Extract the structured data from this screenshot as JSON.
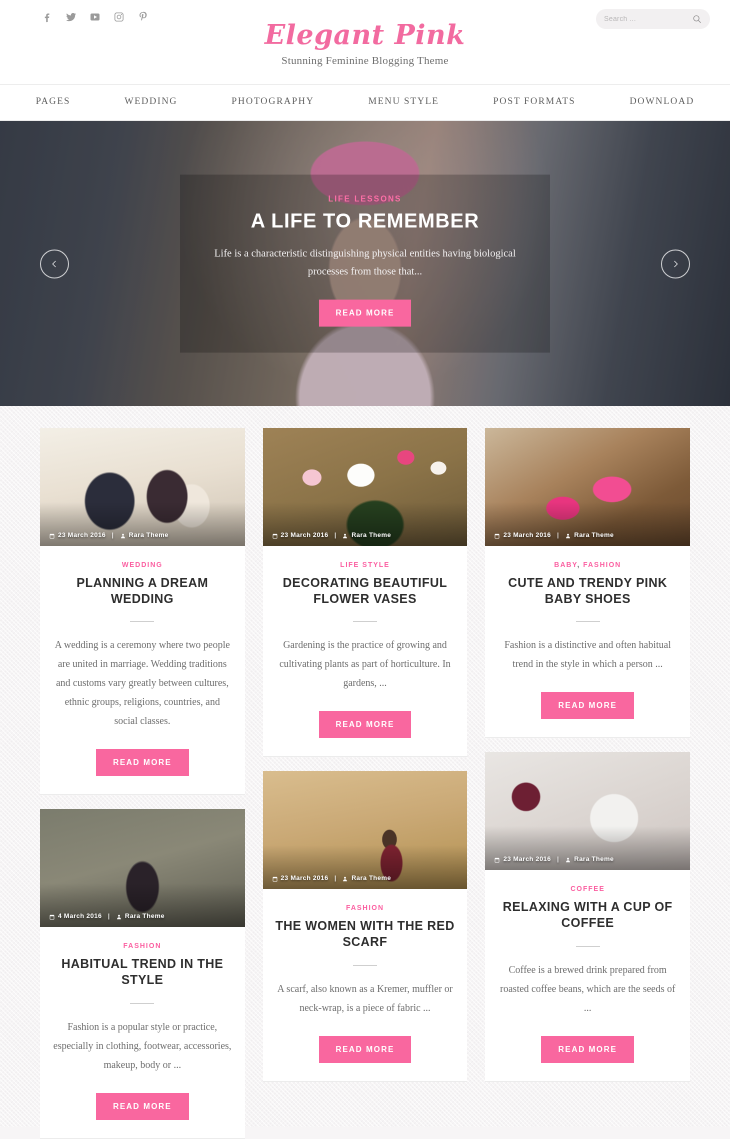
{
  "header": {
    "brand_title": "Elegant Pink",
    "tagline": "Stunning Feminine Blogging Theme",
    "social": [
      {
        "name": "facebook-icon",
        "label": "Facebook"
      },
      {
        "name": "twitter-icon",
        "label": "Twitter"
      },
      {
        "name": "youtube-icon",
        "label": "YouTube"
      },
      {
        "name": "instagram-icon",
        "label": "Instagram"
      },
      {
        "name": "pinterest-icon",
        "label": "Pinterest"
      }
    ],
    "search": {
      "placeholder": "Search ...",
      "value": "",
      "icon": "search-icon"
    }
  },
  "nav": {
    "items": [
      {
        "label": "PAGES"
      },
      {
        "label": "WEDDING"
      },
      {
        "label": "PHOTOGRAPHY"
      },
      {
        "label": "MENU STYLE"
      },
      {
        "label": "POST FORMATS"
      },
      {
        "label": "DOWNLOAD"
      }
    ]
  },
  "hero": {
    "category": "LIFE LESSONS",
    "title": "A LIFE TO REMEMBER",
    "excerpt": "Life is a characteristic distinguishing physical entities having biological processes from those that...",
    "read_more": "READ MORE",
    "prev_icon": "chevron-left-icon",
    "next_icon": "chevron-right-icon"
  },
  "colors": {
    "accent_pink": "#f9679f",
    "brand_pink": "#f26ba0",
    "text_dark": "#2e2e2e",
    "text_body": "#6d6d6d",
    "page_bg": "#f6f4f5"
  },
  "posts": [
    {
      "categories": [
        {
          "label": "WEDDING"
        }
      ],
      "title": "PLANNING A DREAM WEDDING",
      "excerpt": "A wedding is a ceremony where two people are united in marriage. Wedding traditions and customs vary greatly between cultures, ethnic groups, religions, countries, and social classes.",
      "read_more": "READ MORE",
      "date": "23 March 2016",
      "author": "Rara Theme",
      "meta_separator": "|",
      "thumb": "thumb-wedding"
    },
    {
      "categories": [
        {
          "label": "LIFE STYLE"
        }
      ],
      "title": "DECORATING BEAUTIFUL FLOWER VASES",
      "excerpt": "Gardening is the practice of growing and cultivating plants as part of horticulture. In gardens, ...",
      "read_more": "READ MORE",
      "date": "23 March 2016",
      "author": "Rara Theme",
      "meta_separator": "|",
      "thumb": "thumb-flowers"
    },
    {
      "categories": [
        {
          "label": "BABY"
        },
        {
          "label": "FASHION"
        }
      ],
      "title": "CUTE AND TRENDY PINK BABY SHOES",
      "excerpt": "Fashion is a distinctive and often habitual trend in the style in which a person ...",
      "read_more": "READ MORE",
      "date": "23 March 2016",
      "author": "Rara Theme",
      "meta_separator": "|",
      "thumb": "thumb-shoes"
    },
    {
      "categories": [
        {
          "label": "FASHION"
        }
      ],
      "title": "HABITUAL TREND IN THE STYLE",
      "excerpt": "Fashion is a popular style or practice, especially in clothing, footwear, accessories, makeup, body or ...",
      "read_more": "READ MORE",
      "date": "4 March 2016",
      "author": "Rara Theme",
      "meta_separator": "|",
      "thumb": "thumb-sunglasses"
    },
    {
      "categories": [
        {
          "label": "FASHION"
        }
      ],
      "title": "THE WOMEN WITH THE RED SCARF",
      "excerpt": "A scarf, also known as a Kremer, muffler or neck-wrap, is a piece of fabric ...",
      "read_more": "READ MORE",
      "date": "23 March 2016",
      "author": "Rara Theme",
      "meta_separator": "|",
      "thumb": "thumb-field"
    },
    {
      "categories": [
        {
          "label": "COFFEE"
        }
      ],
      "title": "RELAXING WITH A CUP OF COFFEE",
      "excerpt": "Coffee is a brewed drink prepared from roasted coffee beans, which are the seeds of ...",
      "read_more": "READ MORE",
      "date": "23 March 2016",
      "author": "Rara Theme",
      "meta_separator": "|",
      "thumb": "thumb-coffee"
    }
  ]
}
